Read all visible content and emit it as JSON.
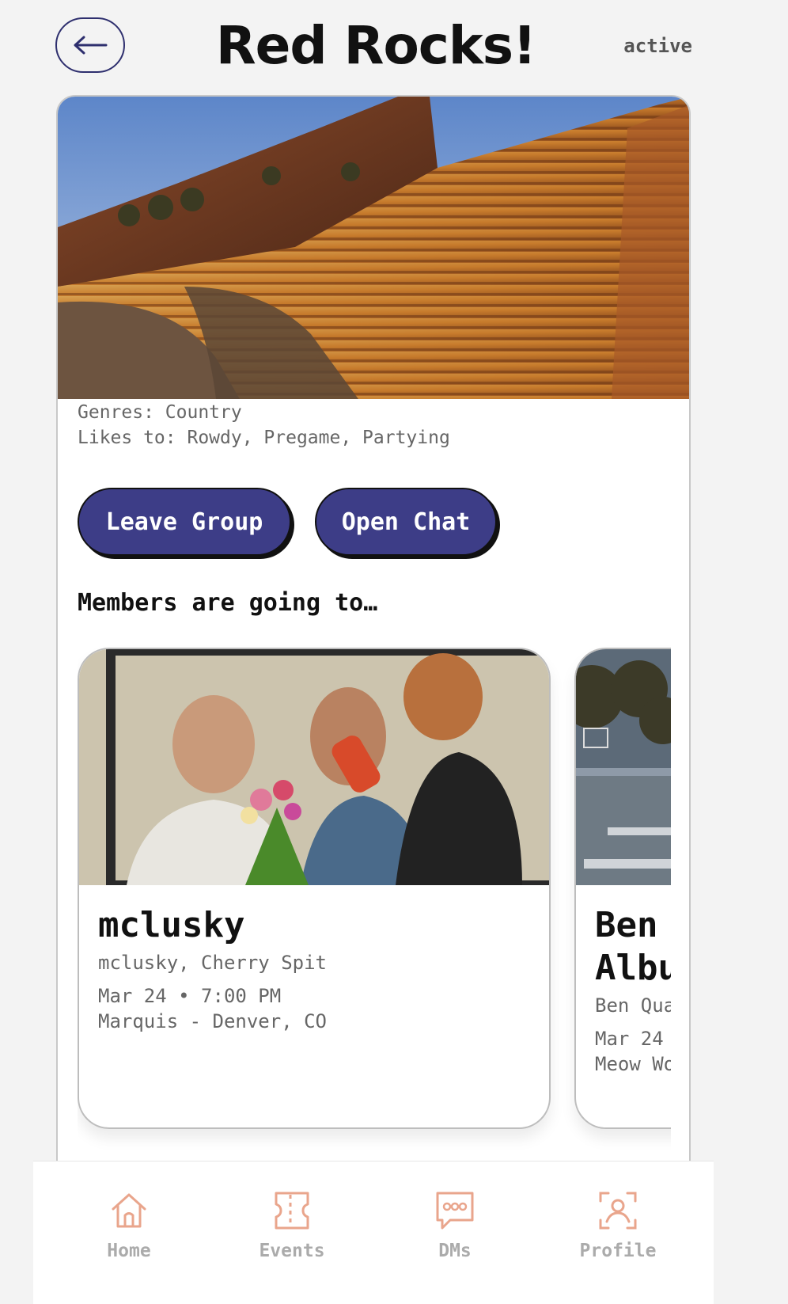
{
  "header": {
    "back_label": "←",
    "title": "Red Rocks!",
    "status": "active"
  },
  "group": {
    "genres": "Genres: Country",
    "likes": "Likes to: Rowdy, Pregame, Partying",
    "leave_label": "Leave Group",
    "chat_label": "Open Chat",
    "members_heading": "Members are going to…"
  },
  "events": [
    {
      "title": "mclusky",
      "artists": "mclusky, Cherry Spit",
      "datetime": "Mar 24 • 7:00 PM",
      "venue": "Marquis - Denver, CO"
    },
    {
      "title_line1": "Ben",
      "title_line2": "Albu",
      "artists": "Ben Qua",
      "datetime": "Mar 24",
      "venue": "Meow Wo"
    }
  ],
  "nav": {
    "home": "Home",
    "events": "Events",
    "dms": "DMs",
    "profile": "Profile"
  },
  "colors": {
    "accent": "#3d3d87",
    "nav_icon": "#e9a58c",
    "nav_label": "#ababab"
  }
}
